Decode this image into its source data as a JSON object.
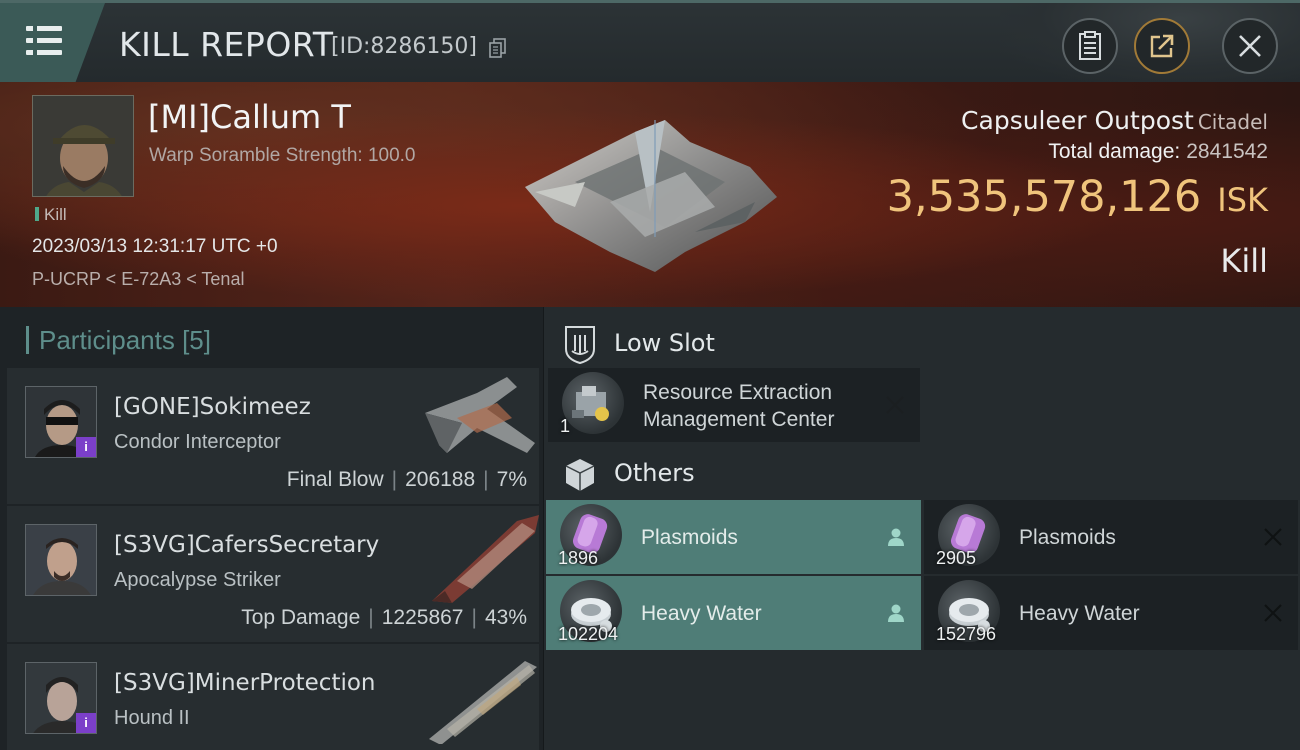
{
  "header": {
    "title": "KILL REPORT",
    "report_id": "[ID:8286150]"
  },
  "victim": {
    "name": "[MI]Callum T",
    "detail": "Warp Soramble Strength: 100.0",
    "tag": "Kill",
    "datetime": "2023/03/13 12:31:17 UTC +0",
    "location": "P-UCRP < E-72A3 < Tenal",
    "structure_name": "Capsuleer Outpost",
    "structure_class": "Citadel",
    "damage_label": "Total damage:",
    "damage_value": "2841542",
    "isk_value": "3,535,578,126",
    "isk_unit": "ISK",
    "result": "Kill"
  },
  "participants": {
    "label": "Participants",
    "count": "[5]",
    "rows": [
      {
        "name": "[GONE]Sokimeez",
        "ship": "Condor Interceptor",
        "role": "Final Blow",
        "damage": "206188",
        "percent": "7%",
        "badge": "i"
      },
      {
        "name": "[S3VG]CafersSecretary",
        "ship": "Apocalypse Striker",
        "role": "Top Damage",
        "damage": "1225867",
        "percent": "43%",
        "badge": ""
      },
      {
        "name": "[S3VG]MinerProtection",
        "ship": "Hound II",
        "role": "",
        "damage": "",
        "percent": "",
        "badge": "i"
      }
    ]
  },
  "items": {
    "low_slot": {
      "label": "Low Slot",
      "entries": [
        {
          "name_line1": "Resource Extraction",
          "name_line2": "Management Center",
          "qty": "1"
        }
      ]
    },
    "others": {
      "label": "Others",
      "entries": [
        {
          "name": "Plasmoids",
          "qty": "1896",
          "state": "dropped"
        },
        {
          "name": "Plasmoids",
          "qty": "2905",
          "state": "destroyed"
        },
        {
          "name": "Heavy Water",
          "qty": "102204",
          "state": "dropped"
        },
        {
          "name": "Heavy Water",
          "qty": "152796",
          "state": "destroyed"
        }
      ]
    }
  },
  "colors": {
    "accent_teal": "#4f7d77",
    "isk_gold": "#f0c47c",
    "participants_teal": "#5e8e8b"
  }
}
